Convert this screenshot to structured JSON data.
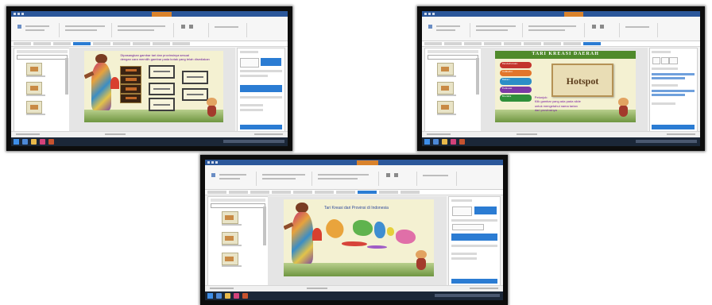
{
  "screenshots": [
    {
      "slide": {
        "caption_line1": "Dipasangkan gambar tari dan provinsinya sesuai",
        "caption_line2": "dengan cara memilih gambar pada kotak yang telah disediakan"
      }
    },
    {
      "slide": {
        "banner": "TARI KREASI DAERAH",
        "button_label": "Hotspot",
        "menu_items": [
          "Pendahuluan",
          "Indikator",
          "Materi",
          "Evaluasi",
          "Biodata"
        ],
        "petunjuk_heading": "Petunjuk:",
        "petunjuk_line1": "Klik gambar yang ada pada slide",
        "petunjuk_line2": "untuk mengetahui nama tarian",
        "petunjuk_line3": "dari provinsinya"
      }
    },
    {
      "slide": {
        "title": "Tari Kreasi dari Provinsi di Indonesia"
      }
    }
  ],
  "colors": {
    "app_bar": "#2b579a",
    "accent_blue": "#2b7cd3",
    "slide_bg": "#f4f1d2",
    "banner_green": "#4f8a2b",
    "button_bg": "#e9ddb5",
    "button_text": "#5a3b1a",
    "petunjuk_text": "#7b1fa2",
    "taskbar": "#1b2738"
  },
  "icons": [
    "dancer-figure",
    "child-mascot-icon",
    "indonesia-map",
    "dance-photo"
  ]
}
